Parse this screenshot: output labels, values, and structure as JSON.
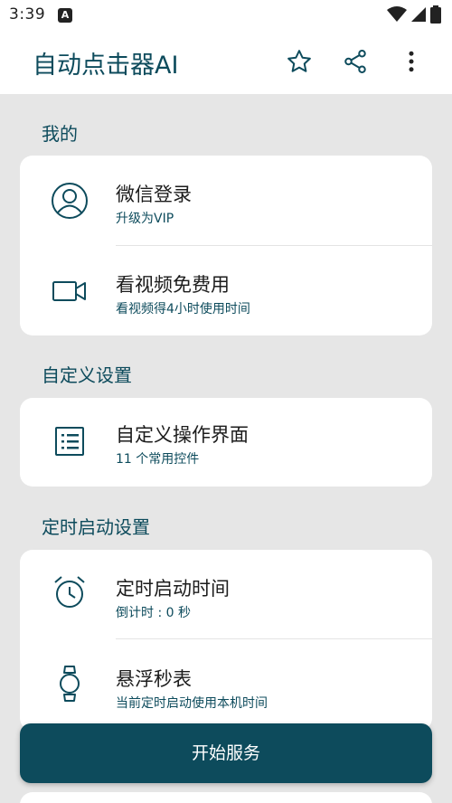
{
  "status_bar": {
    "time": "3:39",
    "notification_icon": "A"
  },
  "app_bar": {
    "title": "自动点击器AI"
  },
  "sections": [
    {
      "title": "我的",
      "items": [
        {
          "title": "微信登录",
          "subtitle": "升级为VIP",
          "icon": "user-circle-icon"
        },
        {
          "title": "看视频免费用",
          "subtitle": "看视频得4小时使用时间",
          "icon": "video-camera-icon"
        }
      ]
    },
    {
      "title": "自定义设置",
      "items": [
        {
          "title": "自定义操作界面",
          "subtitle": "11 个常用控件",
          "icon": "list-icon"
        }
      ]
    },
    {
      "title": "定时启动设置",
      "items": [
        {
          "title": "定时启动时间",
          "subtitle": "倒计时 : 0 秒",
          "icon": "alarm-clock-icon"
        },
        {
          "title": "悬浮秒表",
          "subtitle": "当前定时启动使用本机时间",
          "icon": "watch-icon"
        }
      ]
    }
  ],
  "start_button": {
    "label": "开始服务"
  },
  "colors": {
    "accent": "#0d4b5c",
    "background": "#e6e6e6",
    "card": "#ffffff"
  }
}
